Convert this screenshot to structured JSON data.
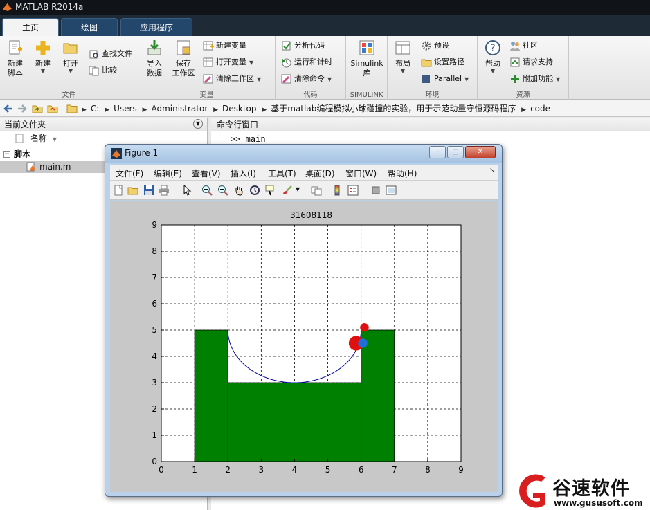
{
  "app": {
    "title": "MATLAB R2014a"
  },
  "tabs": [
    {
      "label": "主页",
      "active": true
    },
    {
      "label": "绘图",
      "active": false
    },
    {
      "label": "应用程序",
      "active": false
    }
  ],
  "ribbon": {
    "file": {
      "label": "文件",
      "new_script": "新建\n脚本",
      "new": "新建",
      "open": "打开",
      "find_files": "查找文件",
      "compare": "比较"
    },
    "variable": {
      "label": "变量",
      "import": "导入\n数据",
      "save_ws": "保存\n工作区",
      "new_var": "新建变量",
      "open_var": "打开变量",
      "clear_ws": "清除工作区"
    },
    "code": {
      "label": "代码",
      "analyze": "分析代码",
      "run_time": "运行和计时",
      "clear_cmd": "清除命令"
    },
    "simulink": {
      "label": "SIMULINK",
      "btn": "Simulink\n库"
    },
    "env": {
      "label": "环境",
      "layout": "布局",
      "prefs": "预设",
      "set_path": "设置路径",
      "parallel": "Parallel"
    },
    "resources": {
      "label": "资源",
      "help": "帮助",
      "community": "社区",
      "support": "请求支持",
      "addons": "附加功能"
    }
  },
  "address": {
    "crumbs": [
      "C:",
      "Users",
      "Administrator",
      "Desktop",
      "基于matlab编程模拟小球碰撞的实验，用于示范动量守恒源码程序",
      "code"
    ]
  },
  "current_folder": {
    "title": "当前文件夹",
    "column_name": "名称",
    "tree": [
      {
        "label": "脚本",
        "type": "folder"
      },
      {
        "label": "main.m",
        "type": "file"
      }
    ]
  },
  "command_window": {
    "title": "命令行窗口",
    "line": ">>  main"
  },
  "figure": {
    "title": "Figure 1",
    "menu": [
      "文件(F)",
      "编辑(E)",
      "查看(V)",
      "插入(I)",
      "工具(T)",
      "桌面(D)",
      "窗口(W)",
      "帮助(H)"
    ],
    "win_buttons": {
      "min": "–",
      "max": "□",
      "close": "✕"
    }
  },
  "chart_data": {
    "type": "area",
    "title": "31608118",
    "xlim": [
      0,
      9
    ],
    "ylim": [
      0,
      9
    ],
    "xticks": [
      0,
      1,
      2,
      3,
      4,
      5,
      6,
      7,
      8,
      9
    ],
    "yticks": [
      0,
      1,
      2,
      3,
      4,
      5,
      6,
      7,
      8,
      9
    ],
    "grid": true,
    "colors": {
      "ground": "#008000",
      "curve": "#0000aa",
      "ball_red": "#e01010",
      "ball_blue": "#1f6fd8"
    },
    "terrain": [
      [
        1,
        0
      ],
      [
        1,
        5
      ],
      [
        2,
        5
      ],
      [
        2,
        3
      ],
      [
        6,
        3
      ],
      [
        6,
        5
      ],
      [
        7,
        5
      ],
      [
        7,
        0
      ]
    ],
    "dividers": [
      2,
      6
    ],
    "curve": {
      "center_x": 4,
      "center_y": 5,
      "radius": 2,
      "min_y": 3
    },
    "balls": [
      {
        "x": 5.85,
        "y": 4.5,
        "r": 0.22,
        "color": "#e01010"
      },
      {
        "x": 6.05,
        "y": 4.5,
        "r": 0.14,
        "color": "#1f6fd8"
      },
      {
        "x": 6.1,
        "y": 5.1,
        "r": 0.13,
        "color": "#e01010"
      }
    ]
  },
  "watermark": {
    "brand": "谷速软件",
    "url": "www.gususoft.com"
  }
}
